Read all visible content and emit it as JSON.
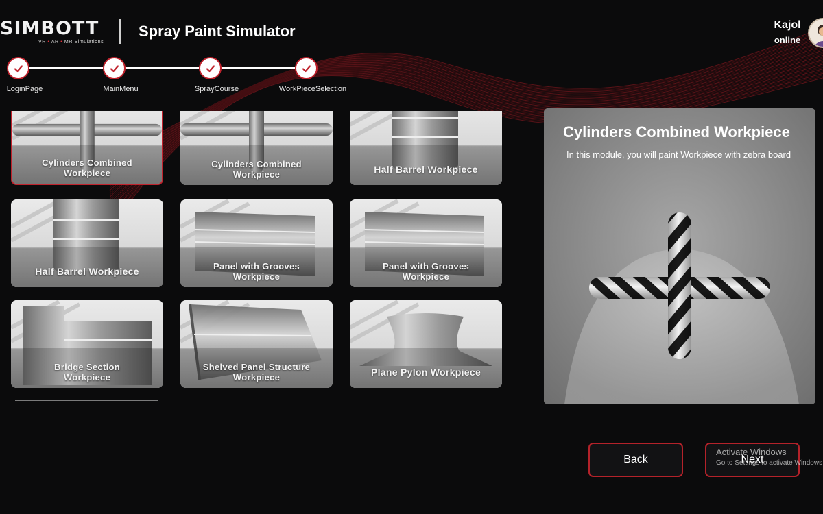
{
  "header": {
    "logo_text": "SIMBOTT",
    "logo_sub": [
      "VR",
      "AR",
      "MR Simulations"
    ],
    "app_title": "Spray Paint Simulator"
  },
  "user": {
    "name": "Kajol",
    "status": "online"
  },
  "stepper": {
    "steps": [
      {
        "label": "LoginPage",
        "done": true
      },
      {
        "label": "MainMenu",
        "done": true
      },
      {
        "label": "SprayCourse",
        "done": true
      },
      {
        "label": "WorkPieceSelection",
        "done": true
      }
    ]
  },
  "workpieces": [
    {
      "label": "Cylinders Combined Workpiece",
      "selected": true
    },
    {
      "label": "Cylinders Combined Workpiece",
      "selected": false
    },
    {
      "label": "Half Barrel Workpiece",
      "selected": false
    },
    {
      "label": "Half Barrel Workpiece",
      "selected": false
    },
    {
      "label": "Panel with Grooves Workpiece",
      "selected": false
    },
    {
      "label": "Panel with Grooves Workpiece",
      "selected": false
    },
    {
      "label": "Bridge Section Workpiece",
      "selected": false
    },
    {
      "label": "Shelved Panel Structure Workpiece",
      "selected": false
    },
    {
      "label": "Plane Pylon Workpiece",
      "selected": false
    }
  ],
  "preview": {
    "title": "Cylinders Combined Workpiece",
    "description": "In this module, you will paint Workpiece with zebra board"
  },
  "buttons": {
    "back": "Back",
    "next": "Next"
  },
  "watermark": {
    "title": "Activate Windows",
    "subtitle": "Go to Settings to activate Windows."
  },
  "colors": {
    "accent": "#c0222c",
    "background": "#0b0b0c"
  }
}
